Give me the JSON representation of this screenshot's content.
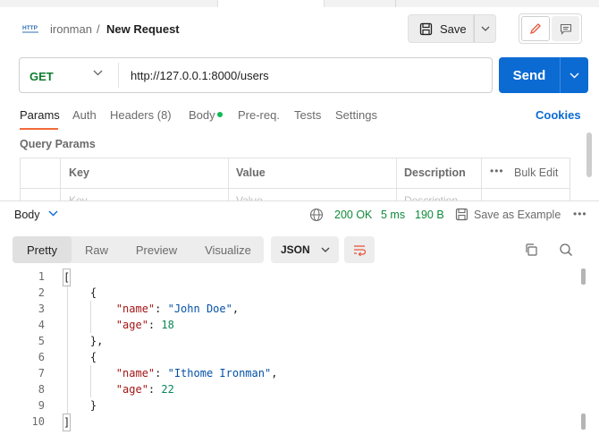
{
  "breadcrumb": {
    "collection": "ironman",
    "separator": "/",
    "request": "New Request"
  },
  "header": {
    "save_label": "Save"
  },
  "request": {
    "method": "GET",
    "url": "http://127.0.0.1:8000/users",
    "send_label": "Send"
  },
  "request_tabs": [
    {
      "label": "Params",
      "active": true
    },
    {
      "label": "Auth"
    },
    {
      "label": "Headers (8)"
    },
    {
      "label": "Body"
    },
    {
      "label": "Pre-req."
    },
    {
      "label": "Tests"
    },
    {
      "label": "Settings"
    }
  ],
  "cookies_label": "Cookies",
  "query_params": {
    "title": "Query Params",
    "columns": [
      "Key",
      "Value",
      "Description"
    ],
    "placeholders": [
      "Key",
      "Value",
      "Description"
    ],
    "bulk_edit": "Bulk Edit",
    "more": "•••"
  },
  "response": {
    "body_label": "Body",
    "status": "200 OK",
    "time": "5 ms",
    "size": "190 B",
    "save_example": "Save as Example",
    "more": "•••",
    "view_tabs": [
      "Pretty",
      "Raw",
      "Preview",
      "Visualize"
    ],
    "format": "JSON",
    "line_numbers": [
      "1",
      "2",
      "3",
      "4",
      "5",
      "6",
      "7",
      "8",
      "9",
      "10"
    ]
  },
  "colors": {
    "accent": "#0b6bd3",
    "method_get": "#0e7c2f",
    "status_ok": "#0e8a3a",
    "tab_underline": "#f26b3a"
  }
}
